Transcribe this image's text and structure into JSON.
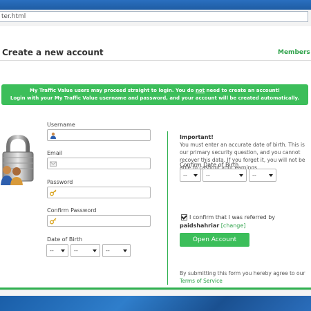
{
  "browser": {
    "url": "ter.html"
  },
  "header": {
    "title": "Create a new account",
    "members_link": "Members Lo"
  },
  "banner": {
    "line1_pre": "My Traffic Value users may proceed straight to login. You do ",
    "line1_em": "not",
    "line1_post": " need to create an account!",
    "line2": "Login with your My Traffic Value username and password, and your account will be created automatically."
  },
  "form": {
    "username_label": "Username",
    "email_label": "Email",
    "password_label": "Password",
    "confirm_password_label": "Confirm Password",
    "dob_label": "Date of Birth",
    "dob_day": "--",
    "dob_month": "--",
    "dob_year": "--"
  },
  "side": {
    "important_title": "Important!",
    "important_text": "You must enter an accurate date of birth. This is our primary security question, and you cannot recover this data. If you forget it, you will not be able to cashout your earnings.",
    "confirm_dob_label": "Confirm Date of Birth",
    "confirm_dob_day": "--",
    "confirm_dob_month": "--",
    "confirm_dob_year": "--",
    "referral_confirm": "I confirm that I was referred by",
    "referrer_name": "paidshahriar",
    "change_link": "[change]",
    "open_button": "Open Account",
    "terms_pre": "By submitting this form you hereby agree to our",
    "terms_link": "Terms of Service"
  },
  "colors": {
    "accent_green": "#3cbe5a",
    "link_green": "#2ea24a"
  },
  "icons": {
    "lock": "padlock-users-icon",
    "username": "user-icon",
    "email": "envelope-icon",
    "password": "key-icon",
    "confirm_password": "key-icon"
  }
}
